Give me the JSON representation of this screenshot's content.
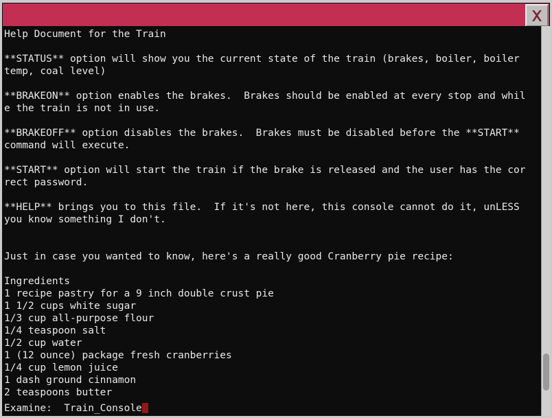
{
  "window": {
    "title": "",
    "frame_color": "#cccccc",
    "titlebar_color": "#c32f52",
    "console_bg": "#0d0d0d",
    "console_fg": "#e8e8e8",
    "cursor_color": "#8f1a1a"
  },
  "titlebar": {
    "close_label": "X",
    "close_icon": "close-icon"
  },
  "console": {
    "body": "Help Document for the Train\n\n**STATUS** option will show you the current state of the train (brakes, boiler, boiler\ntemp, coal level)\n\n**BRAKEON** option enables the brakes.  Brakes should be enabled at every stop and whil\ne the train is not in use.\n\n**BRAKEOFF** option disables the brakes.  Brakes must be disabled before the **START**\ncommand will execute.\n\n**START** option will start the train if the brake is released and the user has the cor\nrect password.\n\n**HELP** brings you to this file.  If it's not here, this console cannot do it, unLESS\nyou know something I don't.\n\n\nJust in case you wanted to know, here's a really good Cranberry pie recipe:\n\nIngredients\n1 recipe pastry for a 9 inch double crust pie\n1 1/2 cups white sugar\n1/3 cup all-purpose flour\n1/4 teaspoon salt\n1/2 cup water\n1 (12 ounce) package fresh cranberries\n1/4 cup lemon juice\n1 dash ground cinnamon\n2 teaspoons butter"
  },
  "status": {
    "prompt_label": "Examine:",
    "prompt_value": "Train_Console",
    "full_line": "Examine:  Train_Console"
  },
  "scrollbar": {
    "orientation": "vertical"
  }
}
